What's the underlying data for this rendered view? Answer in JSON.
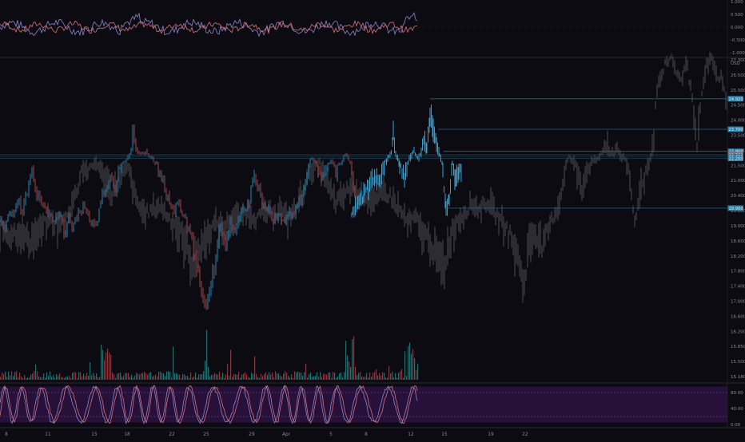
{
  "chart_data": {
    "type": "line",
    "currency": "USD",
    "colors": {
      "background": "#0c0b12",
      "up_candle": "#2fa4d6",
      "down_candle": "#c7555a",
      "projection": "#3a3a40",
      "level_line": "#2b6f8f",
      "osc_fill": "#2a1240",
      "osc_line_a": "#8f86c9",
      "osc_line_b": "#d8737a"
    },
    "oscillator_top": {
      "ticks": [
        "1.000",
        "0.500",
        "0.000",
        "-0.500",
        "-1.000"
      ],
      "ylim": [
        -1,
        1
      ]
    },
    "price_panel": {
      "ticks": [
        {
          "label": "27.300",
          "value": 27.3
        },
        {
          "label": "26.500",
          "value": 26.5
        },
        {
          "label": "25.500",
          "value": 25.5
        },
        {
          "label": "24.500",
          "value": 24.5
        },
        {
          "label": "24.000",
          "value": 24.0
        },
        {
          "label": "23.500",
          "value": 23.5
        },
        {
          "label": "23.000",
          "value": 23.0
        },
        {
          "label": "21.500",
          "value": 21.5
        },
        {
          "label": "21.000",
          "value": 21.0
        },
        {
          "label": "20.400",
          "value": 20.4
        },
        {
          "label": "19.800",
          "value": 19.8
        },
        {
          "label": "19.000",
          "value": 19.0
        },
        {
          "label": "18.600",
          "value": 18.6
        },
        {
          "label": "18.200",
          "value": 18.2
        },
        {
          "label": "17.800",
          "value": 17.8
        },
        {
          "label": "17.400",
          "value": 17.4
        },
        {
          "label": "17.000",
          "value": 17.0
        },
        {
          "label": "16.600",
          "value": 16.6
        },
        {
          "label": "16.200",
          "value": 16.2
        },
        {
          "label": "15.850",
          "value": 15.85
        },
        {
          "label": "15.500",
          "value": 15.5
        },
        {
          "label": "15.180",
          "value": 15.18
        }
      ],
      "levels": [
        {
          "label": "24.920",
          "value": 24.92,
          "tag_color": "#2b7fa6"
        },
        {
          "label": "23.700",
          "value": 23.7,
          "tag_color": "#2b7fa6"
        },
        {
          "label": "22.900",
          "value": 22.9,
          "tag_color": "#2b7fa6"
        },
        {
          "label": "22.560",
          "value": 22.56,
          "tag_color": "#c7555a"
        },
        {
          "label": "22.400",
          "value": 22.4,
          "tag_color": "#2b7fa6"
        },
        {
          "label": "22.200",
          "value": 22.2,
          "tag_color": "#2b7fa6"
        },
        {
          "label": "19.900",
          "value": 19.9,
          "tag_color": "#2b7fa6"
        }
      ],
      "history": [
        [
          0,
          19.2
        ],
        [
          6,
          19.1
        ],
        [
          12,
          19.4
        ],
        [
          16,
          19.8
        ],
        [
          22,
          20.3
        ],
        [
          28,
          19.7
        ],
        [
          34,
          20.6
        ],
        [
          40,
          21.3
        ],
        [
          46,
          20.5
        ],
        [
          52,
          20.0
        ],
        [
          58,
          19.6
        ],
        [
          66,
          19.3
        ],
        [
          74,
          19.8
        ],
        [
          80,
          18.7
        ],
        [
          86,
          19.3
        ],
        [
          92,
          19.0
        ],
        [
          98,
          19.6
        ],
        [
          106,
          19.9
        ],
        [
          114,
          19.2
        ],
        [
          120,
          18.8
        ],
        [
          126,
          20.2
        ],
        [
          132,
          20.8
        ],
        [
          138,
          21.1
        ],
        [
          144,
          20.6
        ],
        [
          150,
          21.5
        ],
        [
          156,
          21.9
        ],
        [
          162,
          22.8
        ],
        [
          166,
          23.6
        ],
        [
          170,
          22.9
        ],
        [
          176,
          22.5
        ],
        [
          182,
          22.7
        ],
        [
          188,
          22.3
        ],
        [
          194,
          21.8
        ],
        [
          200,
          21.2
        ],
        [
          206,
          20.7
        ],
        [
          212,
          20.3
        ],
        [
          218,
          19.7
        ],
        [
          224,
          20.1
        ],
        [
          230,
          19.5
        ],
        [
          236,
          18.9
        ],
        [
          242,
          18.3
        ],
        [
          248,
          17.7
        ],
        [
          254,
          17.2
        ],
        [
          258,
          16.8
        ],
        [
          264,
          17.5
        ],
        [
          270,
          18.2
        ],
        [
          276,
          18.9
        ],
        [
          282,
          18.4
        ],
        [
          288,
          19.2
        ],
        [
          294,
          19.0
        ],
        [
          300,
          19.6
        ],
        [
          306,
          20.0
        ],
        [
          312,
          20.3
        ],
        [
          318,
          21.0
        ],
        [
          324,
          20.6
        ],
        [
          330,
          20.1
        ],
        [
          336,
          19.7
        ],
        [
          342,
          19.4
        ],
        [
          348,
          19.5
        ],
        [
          354,
          19.3
        ],
        [
          360,
          19.8
        ],
        [
          366,
          19.5
        ],
        [
          372,
          19.9
        ],
        [
          378,
          20.6
        ],
        [
          384,
          21.2
        ],
        [
          390,
          22.2
        ],
        [
          396,
          21.4
        ],
        [
          402,
          21.0
        ],
        [
          408,
          21.6
        ],
        [
          414,
          22.0
        ],
        [
          420,
          21.2
        ],
        [
          426,
          21.6
        ],
        [
          432,
          22.6
        ],
        [
          438,
          21.8
        ],
        [
          444,
          20.4
        ],
        [
          448,
          19.3
        ]
      ],
      "highlight": [
        [
          440,
          19.5
        ],
        [
          446,
          19.9
        ],
        [
          452,
          20.3
        ],
        [
          458,
          20.6
        ],
        [
          464,
          20.9
        ],
        [
          470,
          21.2
        ],
        [
          476,
          21.0
        ],
        [
          482,
          21.8
        ],
        [
          488,
          22.6
        ],
        [
          492,
          23.5
        ],
        [
          496,
          22.4
        ],
        [
          500,
          21.6
        ],
        [
          506,
          21.0
        ],
        [
          512,
          22.2
        ],
        [
          518,
          22.8
        ],
        [
          524,
          22.3
        ],
        [
          530,
          23.3
        ],
        [
          534,
          23.0
        ],
        [
          538,
          24.1
        ],
        [
          542,
          23.8
        ],
        [
          546,
          23.1
        ],
        [
          550,
          22.6
        ],
        [
          554,
          21.4
        ],
        [
          558,
          19.8
        ],
        [
          562,
          20.4
        ],
        [
          566,
          21.6
        ],
        [
          570,
          21.0
        ],
        [
          574,
          21.3
        ],
        [
          578,
          21.5
        ]
      ],
      "projection": [
        [
          0,
          19.0
        ],
        [
          12,
          18.8
        ],
        [
          24,
          18.9
        ],
        [
          36,
          18.6
        ],
        [
          48,
          18.9
        ],
        [
          60,
          19.3
        ],
        [
          72,
          19.1
        ],
        [
          84,
          19.5
        ],
        [
          96,
          20.6
        ],
        [
          104,
          21.6
        ],
        [
          112,
          21.3
        ],
        [
          120,
          21.9
        ],
        [
          130,
          21.1
        ],
        [
          140,
          20.5
        ],
        [
          150,
          21.1
        ],
        [
          160,
          21.5
        ],
        [
          170,
          20.2
        ],
        [
          180,
          19.6
        ],
        [
          190,
          19.8
        ],
        [
          200,
          20.0
        ],
        [
          210,
          19.5
        ],
        [
          220,
          19.1
        ],
        [
          230,
          18.6
        ],
        [
          240,
          18.0
        ],
        [
          250,
          18.4
        ],
        [
          260,
          18.8
        ],
        [
          270,
          19.2
        ],
        [
          280,
          19.0
        ],
        [
          290,
          19.4
        ],
        [
          300,
          19.5
        ],
        [
          310,
          19.7
        ],
        [
          320,
          19.4
        ],
        [
          330,
          19.7
        ],
        [
          340,
          19.6
        ],
        [
          350,
          19.8
        ],
        [
          360,
          19.3
        ],
        [
          370,
          19.9
        ],
        [
          380,
          20.6
        ],
        [
          390,
          21.5
        ],
        [
          400,
          21.7
        ],
        [
          410,
          20.8
        ],
        [
          420,
          20.1
        ],
        [
          430,
          20.4
        ],
        [
          440,
          20.8
        ],
        [
          450,
          20.5
        ],
        [
          460,
          20.3
        ],
        [
          470,
          20.1
        ],
        [
          480,
          20.6
        ],
        [
          490,
          20.3
        ],
        [
          500,
          19.8
        ],
        [
          510,
          19.2
        ],
        [
          520,
          19.4
        ],
        [
          530,
          18.8
        ],
        [
          540,
          18.5
        ],
        [
          550,
          18.0
        ],
        [
          556,
          17.9
        ],
        [
          562,
          18.6
        ],
        [
          570,
          19.2
        ],
        [
          580,
          19.6
        ],
        [
          590,
          20.1
        ],
        [
          600,
          19.8
        ],
        [
          610,
          20.2
        ],
        [
          620,
          19.6
        ],
        [
          630,
          19.2
        ],
        [
          640,
          18.6
        ],
        [
          650,
          18.0
        ],
        [
          656,
          17.4
        ],
        [
          662,
          18.6
        ],
        [
          670,
          18.9
        ],
        [
          680,
          18.4
        ],
        [
          690,
          19.3
        ],
        [
          700,
          20.1
        ],
        [
          706,
          21.3
        ],
        [
          712,
          22.3
        ],
        [
          720,
          21.6
        ],
        [
          728,
          20.7
        ],
        [
          736,
          21.6
        ],
        [
          746,
          22.0
        ],
        [
          756,
          23.1
        ],
        [
          764,
          22.6
        ],
        [
          772,
          23.0
        ],
        [
          780,
          22.2
        ],
        [
          788,
          21.0
        ],
        [
          794,
          19.2
        ],
        [
          800,
          20.6
        ],
        [
          806,
          21.0
        ],
        [
          812,
          22.0
        ],
        [
          818,
          23.4
        ],
        [
          822,
          25.6
        ],
        [
          828,
          26.5
        ],
        [
          834,
          27.2
        ],
        [
          840,
          27.6
        ],
        [
          846,
          26.7
        ],
        [
          852,
          26.0
        ],
        [
          858,
          27.4
        ],
        [
          864,
          25.6
        ],
        [
          868,
          24.1
        ],
        [
          872,
          22.9
        ],
        [
          878,
          25.3
        ],
        [
          884,
          27.0
        ],
        [
          890,
          27.6
        ],
        [
          896,
          26.4
        ],
        [
          902,
          26.3
        ],
        [
          908,
          25.0
        ],
        [
          912,
          24.6
        ]
      ]
    },
    "volume": {
      "x_max": 522,
      "color_up": "#2f8f8c",
      "color_down": "#a84b52"
    },
    "oscillator_bottom": {
      "ticks": [
        "80.00",
        "40.00",
        "0.00"
      ],
      "ylim": [
        0,
        100
      ],
      "x_max": 522
    },
    "x_axis": {
      "ticks": [
        {
          "label": "8",
          "x": 8
        },
        {
          "label": "11",
          "x": 60
        },
        {
          "label": "15",
          "x": 118
        },
        {
          "label": "18",
          "x": 159
        },
        {
          "label": "22",
          "x": 215
        },
        {
          "label": "25",
          "x": 258
        },
        {
          "label": "29",
          "x": 315
        },
        {
          "label": "Apr",
          "x": 358
        },
        {
          "label": "5",
          "x": 414
        },
        {
          "label": "8",
          "x": 458
        },
        {
          "label": "12",
          "x": 514
        },
        {
          "label": "15",
          "x": 556
        },
        {
          "label": "19",
          "x": 614
        },
        {
          "label": "22",
          "x": 657
        }
      ]
    }
  }
}
